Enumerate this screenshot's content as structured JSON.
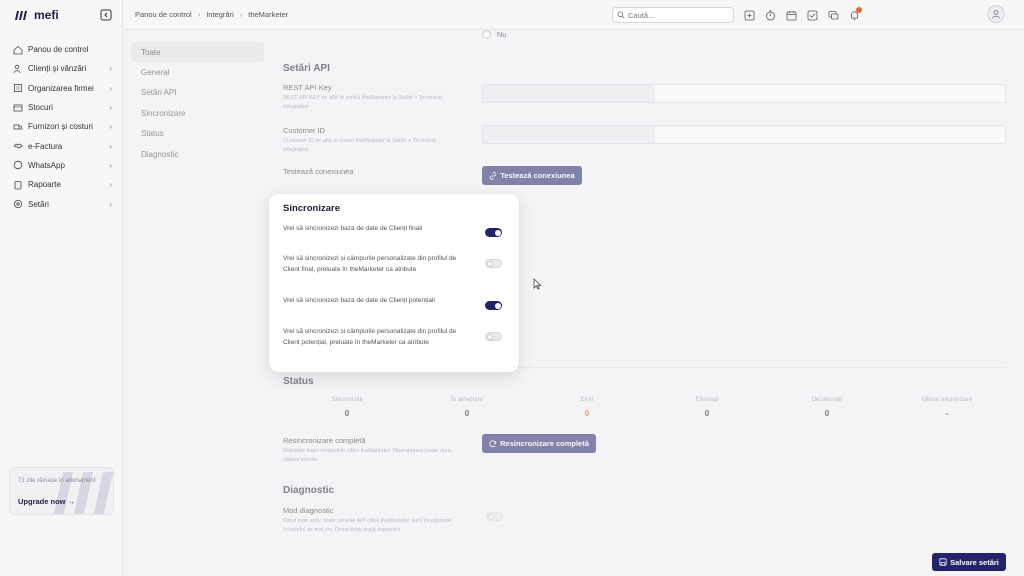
{
  "brand": {
    "name": "mefi",
    "accent": "#23236b",
    "error": "#d4582a"
  },
  "sidebar": {
    "items": [
      {
        "label": "Panou de control",
        "icon": "home-icon",
        "chevron": false
      },
      {
        "label": "Clienți și vânzări",
        "icon": "users-icon",
        "chevron": true
      },
      {
        "label": "Organizarea firmei",
        "icon": "building-icon",
        "chevron": true
      },
      {
        "label": "Stocuri",
        "icon": "box-icon",
        "chevron": true
      },
      {
        "label": "Furnizori și costuri",
        "icon": "truck-icon",
        "chevron": true
      },
      {
        "label": "e-Factura",
        "icon": "handshake-icon",
        "chevron": true
      },
      {
        "label": "WhatsApp",
        "icon": "whatsapp-icon",
        "chevron": true
      },
      {
        "label": "Rapoarte",
        "icon": "clipboard-icon",
        "chevron": true
      },
      {
        "label": "Setări",
        "icon": "gear-icon",
        "chevron": true
      }
    ],
    "chevron_glyph": "›",
    "upgrade": {
      "text": "71 zile rămase în abonament",
      "link": "Upgrade now  →"
    }
  },
  "topbar": {
    "breadcrumb": [
      "Panou de control",
      "Integrări",
      "theMarketer"
    ],
    "separator": "›",
    "search_placeholder": "Caută..."
  },
  "subnav": [
    "Toate",
    "General",
    "Setări API",
    "Sincronizare",
    "Status",
    "Diagnostic"
  ],
  "content": {
    "radio_no": "Nu",
    "api": {
      "title": "Setări API",
      "rest_label": "REST API Key",
      "rest_help": "REST API KEY se află în contul theMarketer la Setări > Technical integration",
      "customer_label": "Customer ID",
      "customer_help": "Customer ID se află în contul theMarketer la Setări > Technical integration",
      "test_label": "Testează conexiunea",
      "test_button": "Testează conexiunea"
    },
    "status": {
      "title": "Status",
      "columns": [
        {
          "label": "Sincronizați",
          "value": "0"
        },
        {
          "label": "În așteptare",
          "value": "0"
        },
        {
          "label": "Erori",
          "value": "0"
        },
        {
          "label": "Eliminați",
          "value": "0"
        },
        {
          "label": "Dezabonați",
          "value": "0"
        },
        {
          "label": "Ultima sincronizare",
          "value": "-"
        }
      ],
      "resync_label": "Resincronizare completă",
      "resync_help": "Retrimite toate contactele către theMarketer. Operațiunea poate dura câteva minute",
      "resync_button": "Resincronizare completă"
    },
    "diagnostic": {
      "title": "Diagnostic",
      "mode_label": "Mod diagnostic",
      "mode_help": "Când este activ, toate cererile API către theMarketer sunt înregistrate în tabelul de mai jos. Dezactivați după depanare",
      "enabled": false
    },
    "save_button": "Salvare setări"
  },
  "modal": {
    "title": "Sincronizare",
    "rows": [
      {
        "text": "Vrei să sincronizezi baza de date de Clienți finali",
        "enabled": true
      },
      {
        "text": "Vrei să sincronizezi și câmpurile personalizate din profilul de Client final, preluate în theMarketer ca atribute",
        "enabled": false
      },
      {
        "text": "Vrei să sincronizezi baza de date de Clienți potențiali",
        "enabled": true
      },
      {
        "text": "Vrei să sincronizezi și câmpurile personalizate din profilul de Client potențial, preluate în theMarketer ca atribute",
        "enabled": false
      }
    ]
  }
}
